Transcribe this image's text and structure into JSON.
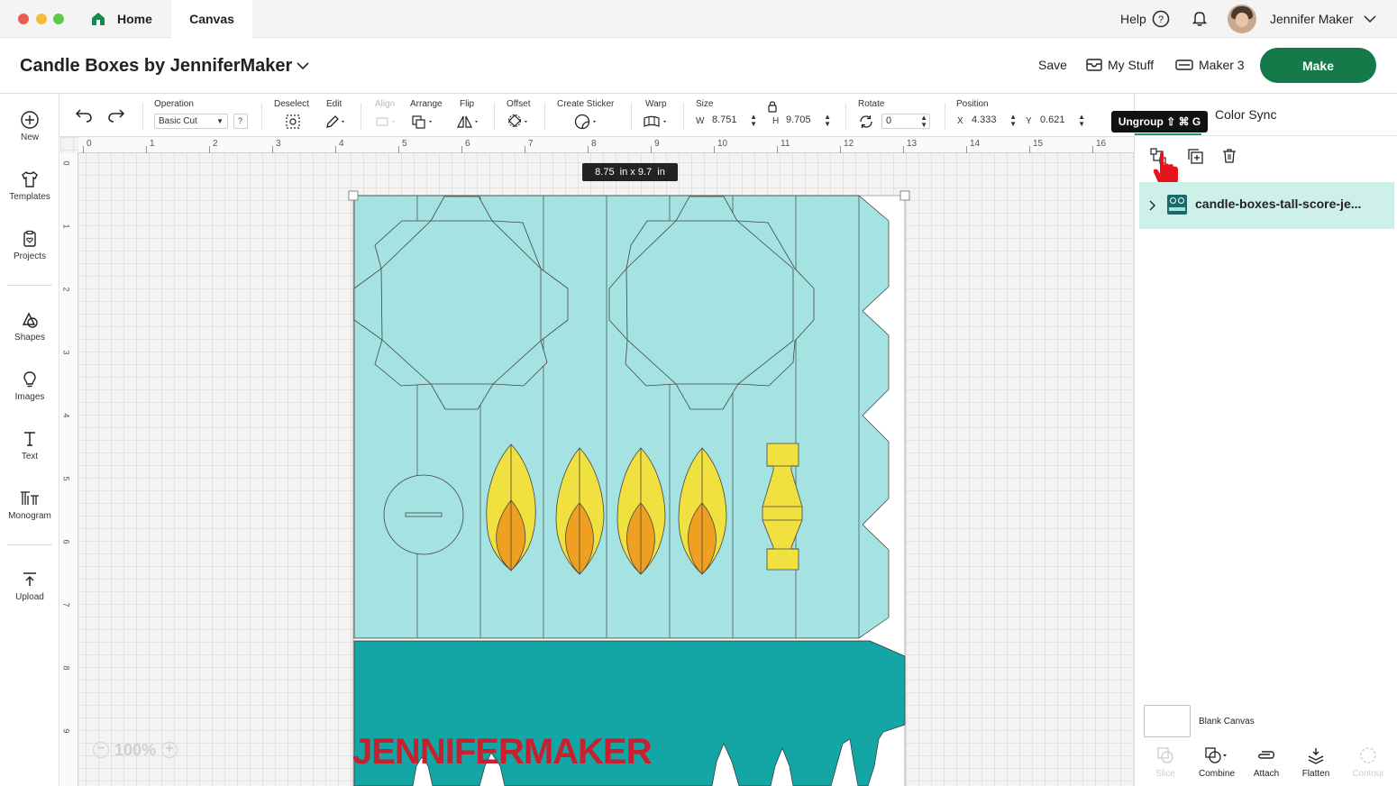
{
  "titlebar": {
    "tabs": [
      "Home",
      "Canvas"
    ],
    "help_label": "Help",
    "user_name": "Jennifer Maker"
  },
  "project": {
    "title": "Candle Boxes by JenniferMaker",
    "save_label": "Save",
    "my_stuff_label": "My Stuff",
    "machine_label": "Maker 3",
    "make_label": "Make"
  },
  "toolbar": {
    "undo_icon": "undo-icon",
    "redo_icon": "redo-icon",
    "operation_label": "Operation",
    "operation_value": "Basic Cut",
    "operation_help": "?",
    "deselect_label": "Deselect",
    "edit_label": "Edit",
    "align_label": "Align",
    "arrange_label": "Arrange",
    "flip_label": "Flip",
    "offset_label": "Offset",
    "create_sticker_label": "Create Sticker",
    "warp_label": "Warp",
    "size_label": "Size",
    "w_label": "W",
    "w_value": "8.751",
    "h_label": "H",
    "h_value": "9.705",
    "rotate_label": "Rotate",
    "rotate_value": "0",
    "position_label": "Position",
    "x_label": "X",
    "x_value": "4.333",
    "y_label": "Y",
    "y_value": "0.621"
  },
  "leftbar": {
    "items": [
      {
        "label": "New",
        "icon": "plus-circle-icon"
      },
      {
        "label": "Templates",
        "icon": "shirt-icon"
      },
      {
        "label": "Projects",
        "icon": "clipboard-heart-icon"
      },
      {
        "label": "Shapes",
        "icon": "shapes-icon"
      },
      {
        "label": "Images",
        "icon": "lightbulb-icon"
      },
      {
        "label": "Text",
        "icon": "text-t-icon"
      },
      {
        "label": "Monogram",
        "icon": "monogram-icon"
      },
      {
        "label": "Upload",
        "icon": "upload-icon"
      }
    ]
  },
  "canvas": {
    "ruler_top": [
      "0",
      "1",
      "2",
      "3",
      "4",
      "5",
      "6",
      "7",
      "8",
      "9",
      "10",
      "11",
      "12",
      "13",
      "14",
      "15",
      "16"
    ],
    "ruler_left": [
      "0",
      "1",
      "2",
      "3",
      "4",
      "5",
      "6",
      "7",
      "8",
      "9"
    ],
    "size_tooltip": "8.75  in x 9.7  in",
    "zoom": "100%",
    "watermark": "JENNIFERMAKER",
    "colors": {
      "teal_light": "#a5e3e3",
      "teal_dark": "#14a5a5",
      "flame_yellow": "#f0e040",
      "flame_orange": "#f0a020",
      "brand_red": "#c8202e"
    }
  },
  "rightpanel": {
    "tooltip": "Ungroup ⇧ ⌘ G",
    "color_sync_tab": "Color Sync",
    "layer_name": "candle-boxes-tall-score-je...",
    "blank_canvas_label": "Blank Canvas",
    "bottom_actions": [
      "Slice",
      "Combine",
      "Attach",
      "Flatten",
      "Contour"
    ]
  }
}
